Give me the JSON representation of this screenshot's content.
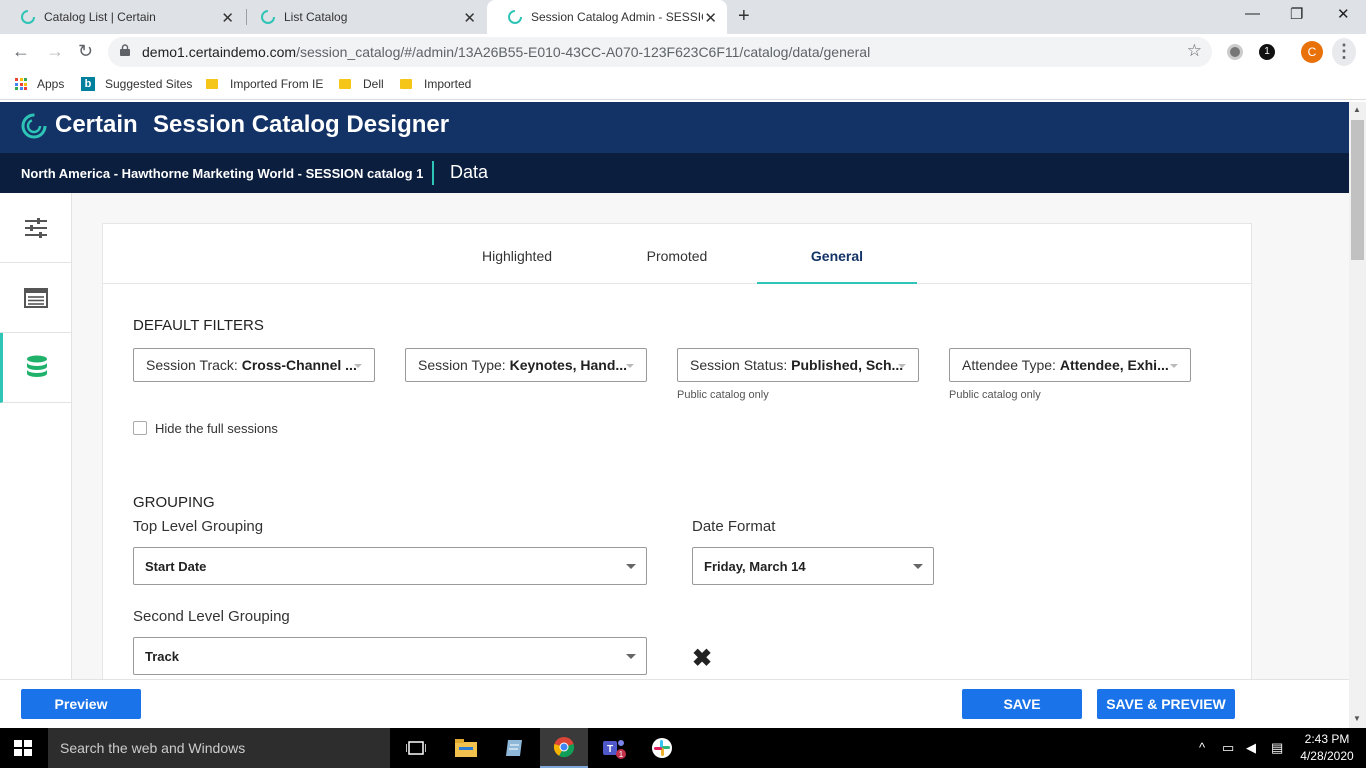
{
  "browser": {
    "tabs": [
      {
        "title": "Catalog List | Certain"
      },
      {
        "title": "List Catalog"
      },
      {
        "title": "Session Catalog Admin - SESSIO"
      }
    ],
    "url_host": "demo1.certaindemo.com",
    "url_path": "/session_catalog/#/admin/13A26B55-E010-43CC-A070-123F623C6F11/catalog/data/general",
    "profile_initial": "C",
    "extension_badge": "1",
    "bookmarks": [
      "Apps",
      "Suggested Sites",
      "Imported From IE",
      "Dell",
      "Imported"
    ]
  },
  "header": {
    "brand": "Certain",
    "product": "Session Catalog Designer",
    "catalog_name": "North America - Hawthorne Marketing World - SESSION catalog 1",
    "section": "Data"
  },
  "rail": {
    "items": [
      {
        "icon": "sliders-icon"
      },
      {
        "icon": "list-icon"
      },
      {
        "icon": "database-icon",
        "active": true
      }
    ]
  },
  "content_tabs": [
    "Highlighted",
    "Promoted",
    "General"
  ],
  "active_tab": "General",
  "default_filters": {
    "title": "DEFAULT FILTERS",
    "filters": [
      {
        "label": "Session Track: ",
        "value": "Cross-Channel ...",
        "hint": ""
      },
      {
        "label": "Session Type: ",
        "value": "Keynotes, Hand...",
        "hint": ""
      },
      {
        "label": "Session Status: ",
        "value": "Published, Sch...",
        "hint": "Public catalog only"
      },
      {
        "label": "Attendee Type: ",
        "value": "Attendee, Exhi...",
        "hint": "Public catalog only"
      }
    ],
    "hide_full_label": "Hide the full sessions",
    "hide_full_checked": false
  },
  "grouping": {
    "title": "GROUPING",
    "top_level_label": "Top Level Grouping",
    "top_level_value": "Start Date",
    "date_format_label": "Date Format",
    "date_format_value": "Friday, March 14",
    "second_level_label": "Second Level Grouping",
    "second_level_value": "Track",
    "remove_symbol": "✖"
  },
  "footer": {
    "preview_label": "Preview",
    "save_label": "SAVE",
    "save_preview_label": "SAVE & PREVIEW"
  },
  "taskbar": {
    "search_placeholder": "Search the web and Windows",
    "time": "2:43 PM",
    "date": "4/28/2020"
  },
  "colors": {
    "header_navy": "#133366",
    "subheader_navy": "#0b1e3e",
    "accent_teal": "#2ec4b6",
    "button_blue": "#1a73e8"
  }
}
